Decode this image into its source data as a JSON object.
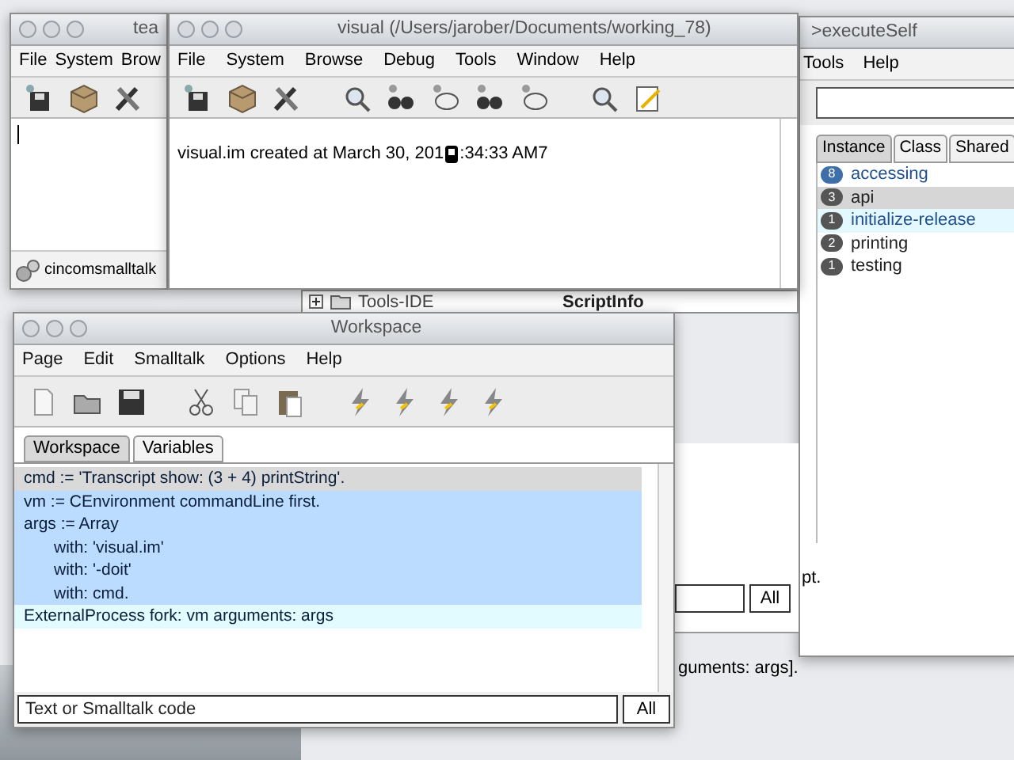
{
  "back_window": {
    "title": "tea",
    "menu": [
      "File",
      "System",
      "Brow"
    ],
    "status": "cincomsmalltalk"
  },
  "transcript_window": {
    "title": "visual (/Users/jarober/Documents/working_78)",
    "menu": [
      "File",
      "System",
      "Browse",
      "Debug",
      "Tools",
      "Window",
      "Help"
    ],
    "text_before_cursor": "visual.im created at March 30, 201",
    "text_after_cursor": ":34:33 AM7"
  },
  "browser_window": {
    "title": ">executeSelf",
    "menu": [
      "Tools",
      "Help"
    ],
    "tabs": [
      {
        "label": "Instance",
        "selected": true
      },
      {
        "label": "Class",
        "selected": false
      },
      {
        "label": "Shared",
        "selected": false
      }
    ],
    "protocols": [
      {
        "count": "8",
        "name": "accessing",
        "color": "#3f6fa8",
        "selected": false,
        "highlighted": false
      },
      {
        "count": "3",
        "name": "api",
        "color": "#555555",
        "selected": true,
        "highlighted": false
      },
      {
        "count": "1",
        "name": "initialize-release",
        "color": "#555555",
        "selected": false,
        "highlighted": true
      },
      {
        "count": "2",
        "name": "printing",
        "color": "#555555",
        "selected": false,
        "highlighted": false
      },
      {
        "count": "1",
        "name": "testing",
        "color": "#555555",
        "selected": false,
        "highlighted": false
      }
    ],
    "text_fragment_1": "pt.",
    "filter_button": "All",
    "text_fragment_2": "guments: args]."
  },
  "package_window": {
    "items": [
      "Tools-IDE",
      "ScriptInfo"
    ]
  },
  "workspace": {
    "title": "Workspace",
    "menu": [
      "Page",
      "Edit",
      "Smalltalk",
      "Options",
      "Help"
    ],
    "tabs": [
      {
        "label": "Workspace",
        "selected": true
      },
      {
        "label": "Variables",
        "selected": false
      }
    ],
    "lines": [
      {
        "text": "cmd := 'Transcript show: (3 + 4) printString'.",
        "kind": "statement",
        "current": true,
        "selected": false,
        "found": false
      },
      {
        "text": "vm := CEnvironment commandLine first.",
        "kind": "statement",
        "current": false,
        "selected": true,
        "found": false
      },
      {
        "text": "args := Array",
        "kind": "statement",
        "current": false,
        "selected": true,
        "found": false
      },
      {
        "text": "with: 'visual.im'",
        "kind": "continuation",
        "current": false,
        "selected": true,
        "found": false
      },
      {
        "text": "with: '-doit'",
        "kind": "continuation",
        "current": false,
        "selected": true,
        "found": false
      },
      {
        "text": "with:  cmd.",
        "kind": "continuation",
        "current": false,
        "selected": true,
        "found": false
      },
      {
        "text": "ExternalProcess fork: vm arguments: args",
        "kind": "statement",
        "current": false,
        "selected": false,
        "found": true
      }
    ],
    "search_placeholder": "Text or Smalltalk code",
    "filter_button": "All"
  }
}
